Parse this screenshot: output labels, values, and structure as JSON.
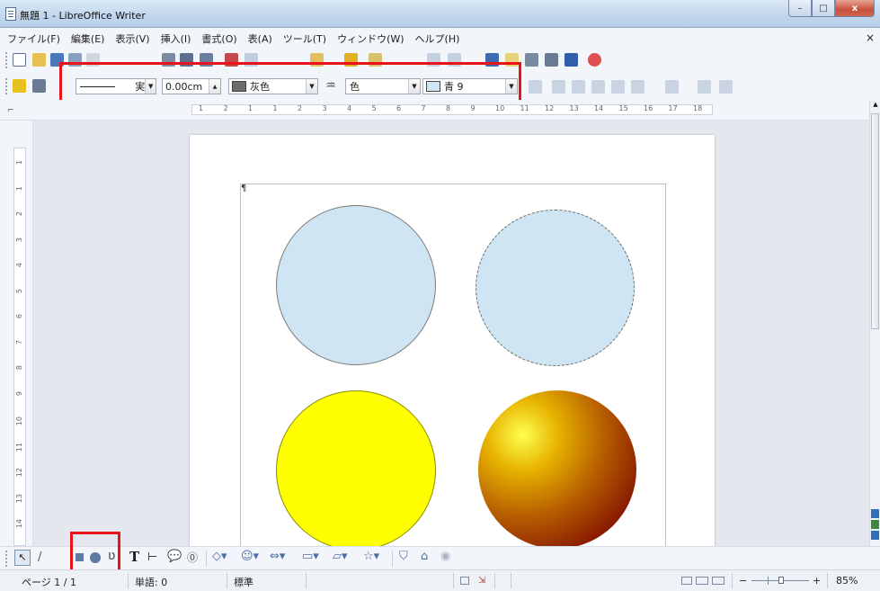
{
  "window": {
    "title": "無題 1 - LibreOffice Writer",
    "minimize": "–",
    "maximize": "□",
    "close": "x"
  },
  "menu": {
    "items": [
      "ファイル(F)",
      "編集(E)",
      "表示(V)",
      "挿入(I)",
      "書式(O)",
      "表(A)",
      "ツール(T)",
      "ウィンドウ(W)",
      "ヘルプ(H)"
    ],
    "close_doc": "×"
  },
  "drawing_props": {
    "line_style_value": "実",
    "line_width_value": "0.00cm",
    "line_color_value": "灰色",
    "line_color_swatch": "#6b6b6b",
    "area_style_value": "色",
    "area_color_value": "青 9",
    "area_color_swatch": "#cfe5f3"
  },
  "ruler": {
    "marks": [
      "1",
      "2",
      "1",
      "1",
      "2",
      "3",
      "4",
      "5",
      "6",
      "7",
      "8",
      "9",
      "10",
      "11",
      "12",
      "13",
      "14",
      "15",
      "16",
      "17",
      "18"
    ]
  },
  "vruler": {
    "marks": [
      "1",
      "1",
      "2",
      "3",
      "4",
      "5",
      "6",
      "7",
      "8",
      "9",
      "10",
      "11",
      "12",
      "13",
      "14"
    ]
  },
  "document": {
    "paragraph_mark": "¶",
    "shapes": [
      {
        "name": "circle-light-blue-solid",
        "fill": "#cfe5f3",
        "border": "solid #7a7a7a"
      },
      {
        "name": "circle-light-blue-dashed",
        "fill": "#cfe5f3",
        "border": "dashed #6a6a6a"
      },
      {
        "name": "circle-yellow",
        "fill": "#ffff00",
        "border": "solid #8a8a00"
      },
      {
        "name": "circle-gradient",
        "fill": "radial yellow to dark red",
        "border": "none"
      }
    ]
  },
  "drawbar": {
    "text_tool_label": "T",
    "icons": [
      "select-arrow-icon",
      "line-icon",
      "rectangle-icon",
      "ellipse-icon",
      "curve-icon",
      "text-icon",
      "dimension-line-icon",
      "callout-icon",
      "fontwork-icon",
      "basic-shapes-icon",
      "symbol-shapes-icon",
      "block-arrows-icon",
      "flowchart-icon",
      "callouts-icon",
      "stars-icon",
      "points-icon",
      "extrusion-icon"
    ]
  },
  "status": {
    "page": "ページ 1 / 1",
    "words": "単語: 0",
    "style": "標準",
    "zoom": "85%",
    "zoom_minus": "−",
    "zoom_plus": "+"
  },
  "colors": {
    "highlight_red": "#e8141a",
    "ui_bg": "#f2f5fa"
  }
}
